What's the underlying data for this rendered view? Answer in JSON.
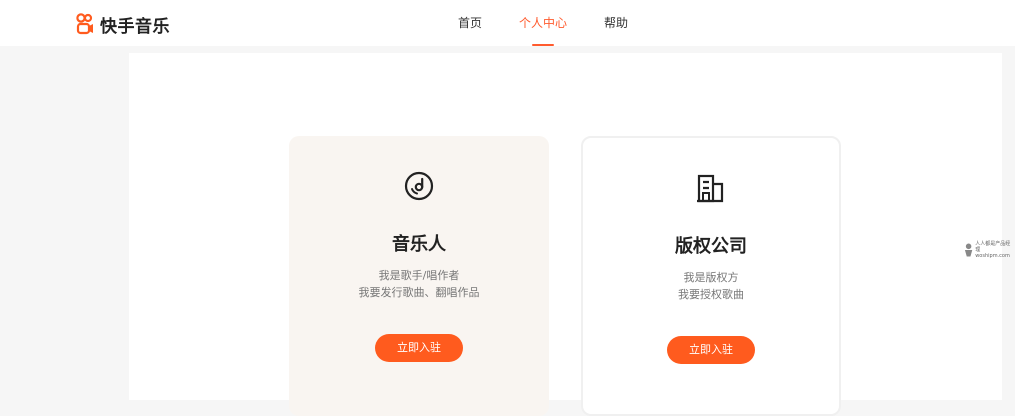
{
  "header": {
    "logo_text": "快手音乐",
    "nav": [
      {
        "label": "首页",
        "active": false
      },
      {
        "label": "个人中心",
        "active": true
      },
      {
        "label": "帮助",
        "active": false
      }
    ]
  },
  "cards": [
    {
      "icon": "music-disc-icon",
      "title": "音乐人",
      "desc_line1": "我是歌手/唱作者",
      "desc_line2": "我要发行歌曲、翻唱作品",
      "button": "立即入驻"
    },
    {
      "icon": "building-icon",
      "title": "版权公司",
      "desc_line1": "我是版权方",
      "desc_line2": "我要授权歌曲",
      "button": "立即入驻"
    }
  ],
  "watermark": {
    "line1": "人人都是产品经理",
    "line2": "woshipm.com"
  },
  "colors": {
    "accent": "#ff5b1e",
    "card_musician_bg": "#f9f5f1"
  }
}
